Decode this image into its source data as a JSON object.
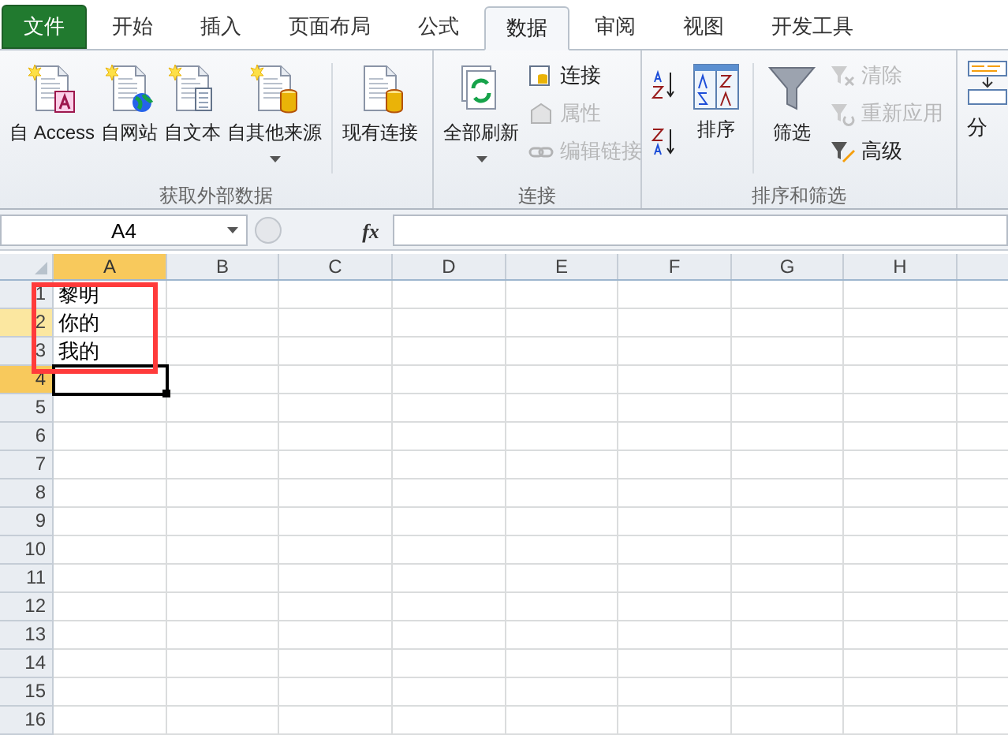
{
  "tabs": [
    {
      "label": "文件",
      "kind": "file",
      "selected": false
    },
    {
      "label": "开始",
      "kind": "tab",
      "selected": false
    },
    {
      "label": "插入",
      "kind": "tab",
      "selected": false
    },
    {
      "label": "页面布局",
      "kind": "tab",
      "selected": false
    },
    {
      "label": "公式",
      "kind": "tab",
      "selected": false
    },
    {
      "label": "数据",
      "kind": "tab",
      "selected": true
    },
    {
      "label": "审阅",
      "kind": "tab",
      "selected": false
    },
    {
      "label": "视图",
      "kind": "tab",
      "selected": false
    },
    {
      "label": "开发工具",
      "kind": "tab",
      "selected": false
    }
  ],
  "ribbon": {
    "external": {
      "label": "获取外部数据",
      "buttons": [
        {
          "label": "自 Access",
          "dropdown": false
        },
        {
          "label": "自网站",
          "dropdown": false
        },
        {
          "label": "自文本",
          "dropdown": false
        },
        {
          "label": "自其他来源",
          "dropdown": true
        },
        {
          "label": "现有连接",
          "dropdown": false
        }
      ]
    },
    "connections": {
      "label": "连接",
      "large": {
        "label": "全部刷新",
        "dropdown": true
      },
      "small": [
        {
          "label": "连接",
          "disabled": false
        },
        {
          "label": "属性",
          "disabled": true
        },
        {
          "label": "编辑链接",
          "disabled": true
        }
      ]
    },
    "sort_filter": {
      "label": "排序和筛选",
      "sort": {
        "label": "排序"
      },
      "filter": {
        "label": "筛选"
      },
      "small": [
        {
          "label": "清除",
          "disabled": true
        },
        {
          "label": "重新应用",
          "disabled": true
        },
        {
          "label": "高级",
          "disabled": false
        }
      ]
    },
    "partial_group": {
      "label": "分"
    }
  },
  "formula_bar": {
    "name_box": "A4",
    "fx": "fx"
  },
  "sheet": {
    "columns": [
      {
        "label": "A",
        "selected": true
      },
      {
        "label": "B",
        "selected": false
      },
      {
        "label": "C",
        "selected": false
      },
      {
        "label": "D",
        "selected": false
      },
      {
        "label": "E",
        "selected": false
      },
      {
        "label": "F",
        "selected": false
      },
      {
        "label": "G",
        "selected": false
      },
      {
        "label": "H",
        "selected": false
      }
    ],
    "rows": [
      {
        "label": "1",
        "selected": false,
        "hovered": false,
        "cell": {
          "text": "黎明",
          "active": false
        }
      },
      {
        "label": "2",
        "selected": false,
        "hovered": true,
        "cell": {
          "text": "你的",
          "active": false
        }
      },
      {
        "label": "3",
        "selected": false,
        "hovered": false,
        "cell": {
          "text": "我的",
          "active": false
        }
      },
      {
        "label": "4",
        "selected": true,
        "hovered": false,
        "cell": {
          "active": true
        }
      },
      {
        "label": "5",
        "selected": false,
        "hovered": false
      },
      {
        "label": "6",
        "selected": false,
        "hovered": false
      },
      {
        "label": "7",
        "selected": false,
        "hovered": false
      },
      {
        "label": "8",
        "selected": false,
        "hovered": false
      },
      {
        "label": "9",
        "selected": false,
        "hovered": false
      },
      {
        "label": "10",
        "selected": false,
        "hovered": false
      },
      {
        "label": "11",
        "selected": false,
        "hovered": false
      },
      {
        "label": "12",
        "selected": false,
        "hovered": false
      },
      {
        "label": "13",
        "selected": false,
        "hovered": false
      },
      {
        "label": "14",
        "selected": false,
        "hovered": false
      },
      {
        "label": "15",
        "selected": false,
        "hovered": false
      },
      {
        "label": "16",
        "selected": false,
        "hovered": false
      }
    ]
  }
}
